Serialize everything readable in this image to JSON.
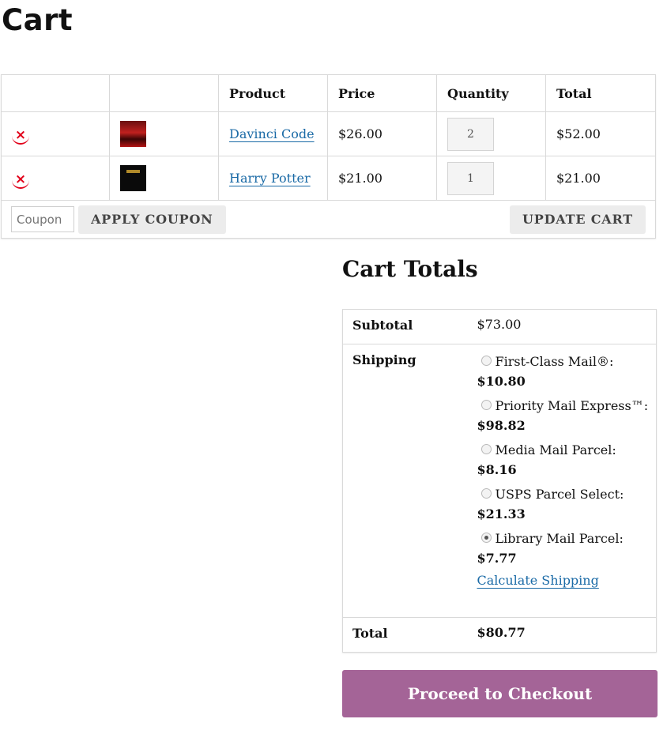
{
  "page": {
    "title": "Cart"
  },
  "cart": {
    "headers": {
      "remove": "",
      "thumbnail": "",
      "product": "Product",
      "price": "Price",
      "quantity": "Quantity",
      "total": "Total"
    },
    "items": [
      {
        "remove": "×",
        "thumbnail_icon": "book-cover-davinci",
        "name": "Davinci Code",
        "price": "$26.00",
        "quantity": "2",
        "total": "$52.00"
      },
      {
        "remove": "×",
        "thumbnail_icon": "book-cover-harry-potter",
        "name": "Harry Potter",
        "price": "$21.00",
        "quantity": "1",
        "total": "$21.00"
      }
    ],
    "coupon_placeholder": "Coupon",
    "apply_coupon_label": "APPLY COUPON",
    "update_cart_label": "UPDATE CART"
  },
  "totals": {
    "title": "Cart Totals",
    "subtotal_label": "Subtotal",
    "subtotal_value": "$73.00",
    "shipping_label": "Shipping",
    "shipping_options": [
      {
        "label": "First-Class Mail®: ",
        "cost": "$10.80",
        "checked": false
      },
      {
        "label": "Priority Mail Express™: ",
        "cost": "$98.82",
        "checked": false
      },
      {
        "label": "Media Mail Parcel: ",
        "cost": "$8.16",
        "checked": false
      },
      {
        "label": "USPS Parcel Select: ",
        "cost": "$21.33",
        "checked": false
      },
      {
        "label": "Library Mail Parcel: ",
        "cost": "$7.77",
        "checked": true
      }
    ],
    "calculate_shipping_label": "Calculate Shipping",
    "total_label": "Total",
    "total_value": "$80.77",
    "checkout_label": "Proceed to Checkout"
  },
  "colors": {
    "accent": "#a46497",
    "link": "#1a6aa6",
    "remove": "#e2001a"
  }
}
